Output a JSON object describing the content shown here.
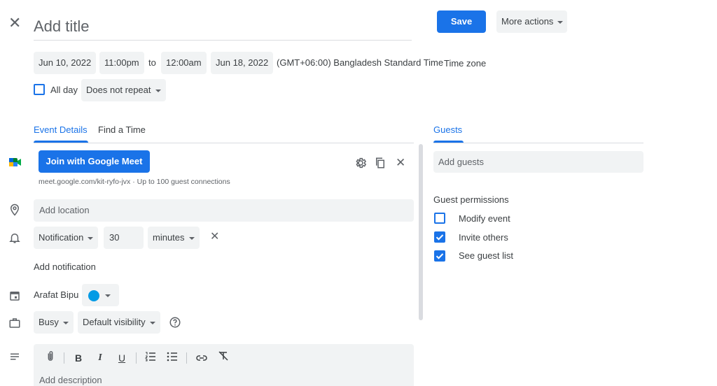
{
  "header": {
    "title_placeholder": "Add title",
    "save_label": "Save",
    "more_actions_label": "More actions"
  },
  "datetime": {
    "start_date": "Jun 10, 2022",
    "start_time": "11:00pm",
    "to_label": "to",
    "end_time": "12:00am",
    "end_date": "Jun 18, 2022",
    "timezone_text": "(GMT+06:00) Bangladesh Standard Time",
    "timezone_link": "Time zone",
    "all_day_label": "All day",
    "all_day_checked": false,
    "repeat": "Does not repeat"
  },
  "tabs": {
    "event_details": "Event Details",
    "find_a_time": "Find a Time",
    "active": "Event Details"
  },
  "meet": {
    "button_label": "Join with Google Meet",
    "link_text": "meet.google.com/kit-ryfo-jvx · Up to 100 guest connections"
  },
  "location": {
    "placeholder": "Add location"
  },
  "notification": {
    "type": "Notification",
    "value": "30",
    "unit": "minutes",
    "add_label": "Add notification"
  },
  "calendar": {
    "owner": "Arafat Bipu",
    "color": "#039be5"
  },
  "availability": {
    "status": "Busy",
    "visibility": "Default visibility"
  },
  "description": {
    "placeholder": "Add description"
  },
  "guests": {
    "heading": "Guests",
    "input_placeholder": "Add guests",
    "permissions_heading": "Guest permissions",
    "permissions": [
      {
        "label": "Modify event",
        "checked": false
      },
      {
        "label": "Invite others",
        "checked": true
      },
      {
        "label": "See guest list",
        "checked": true
      }
    ]
  },
  "colors": {
    "accent": "#1a73e8",
    "chip_bg": "#f1f3f4",
    "text": "#3c4043",
    "muted": "#5f6368"
  }
}
